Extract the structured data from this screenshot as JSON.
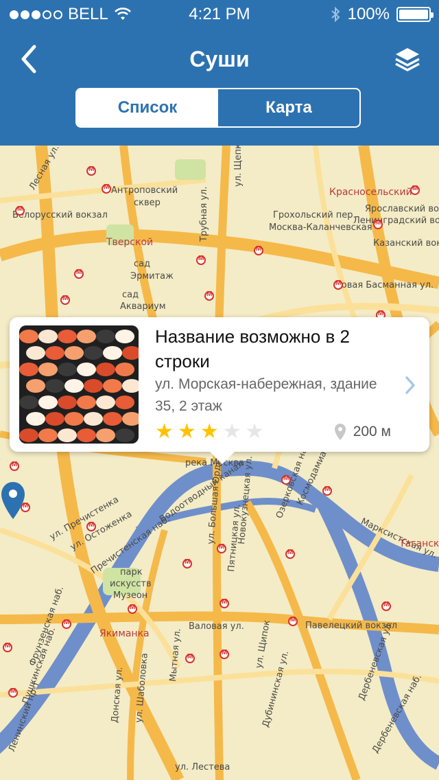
{
  "status_bar": {
    "carrier": "BELL",
    "time": "4:21 PM",
    "battery": "100%",
    "signal_dots_filled": 3,
    "signal_dots_total": 5
  },
  "nav": {
    "title": "Суши",
    "back_icon": "chevron-left-icon",
    "layers_icon": "layers-icon"
  },
  "segments": [
    {
      "label": "Список",
      "active": true
    },
    {
      "label": "Карта",
      "active": false
    }
  ],
  "map": {
    "labels": [
      {
        "text": "Антроповский",
        "cls": ""
      },
      {
        "text": "сквер",
        "cls": ""
      },
      {
        "text": "Белорусский вокзал",
        "cls": ""
      },
      {
        "text": "Тверской",
        "cls": "red"
      },
      {
        "text": "сад",
        "cls": ""
      },
      {
        "text": "Эрмитаж",
        "cls": ""
      },
      {
        "text": "сад",
        "cls": ""
      },
      {
        "text": "Аквариум",
        "cls": ""
      },
      {
        "text": "Грохольский пер.",
        "cls": ""
      },
      {
        "text": "Москва-Каланчевская",
        "cls": ""
      },
      {
        "text": "Красносельский",
        "cls": "red"
      },
      {
        "text": "Ярославский вокзал",
        "cls": ""
      },
      {
        "text": "Ленинградский вокзал",
        "cls": ""
      },
      {
        "text": "Казанский вокзал",
        "cls": ""
      },
      {
        "text": "Новая Басманная ул.",
        "cls": ""
      },
      {
        "text": "Трубная ул.",
        "cls": ""
      },
      {
        "text": "ул. Щепкина",
        "cls": ""
      },
      {
        "text": "Лесная ул.",
        "cls": ""
      },
      {
        "text": "ул. Пречистенка",
        "cls": ""
      },
      {
        "text": "ул. Остоженка",
        "cls": ""
      },
      {
        "text": "Пречистенская наб.",
        "cls": ""
      },
      {
        "text": "парк",
        "cls": ""
      },
      {
        "text": "искусств",
        "cls": ""
      },
      {
        "text": "Музеон",
        "cls": ""
      },
      {
        "text": "Якиманка",
        "cls": "red"
      },
      {
        "text": "Фрунзенская наб.",
        "cls": ""
      },
      {
        "text": "Пушкинская наб.",
        "cls": ""
      },
      {
        "text": "Ленинский пр-т",
        "cls": ""
      },
      {
        "text": "Валовая ул.",
        "cls": ""
      },
      {
        "text": "Павелецкий вокзал",
        "cls": ""
      },
      {
        "text": "Мытная ул.",
        "cls": ""
      },
      {
        "text": "ул. Шаболовка",
        "cls": ""
      },
      {
        "text": "Донская ул.",
        "cls": ""
      },
      {
        "text": "ул. Лестева",
        "cls": ""
      },
      {
        "text": "Дубининская ул.",
        "cls": ""
      },
      {
        "text": "ул. Большая Ордынка",
        "cls": ""
      },
      {
        "text": "Пятницкая ул.",
        "cls": ""
      },
      {
        "text": "Новокузнецкая ул.",
        "cls": ""
      },
      {
        "text": "Озерковская наб.",
        "cls": ""
      },
      {
        "text": "Космодамианская наб.",
        "cls": ""
      },
      {
        "text": "Марксистская ул.",
        "cls": ""
      },
      {
        "text": "Таганский",
        "cls": "red"
      },
      {
        "text": "Дербеневская ул.",
        "cls": ""
      },
      {
        "text": "Дербеневская наб.",
        "cls": ""
      },
      {
        "text": "ул. Щипок",
        "cls": ""
      },
      {
        "text": "Водоотводный канал",
        "cls": ""
      },
      {
        "text": "река Москва",
        "cls": ""
      }
    ]
  },
  "card": {
    "title": "Название возможно в 2 строки",
    "address": "ул. Морская-набережная, здание 35, 2 этаж",
    "rating": 3,
    "rating_max": 5,
    "distance": "200 м",
    "thumb_icon": "sushi-photo",
    "location_icon": "location-pin-icon",
    "chevron_icon": "chevron-right-icon"
  },
  "colors": {
    "header": "#2d72b0",
    "map_bg": "#f4ecc6",
    "road_major": "#f5b94a",
    "road_minor": "#fbe09a",
    "river": "#6f8fcb",
    "star_on": "#ffc300",
    "star_off": "#e6e6e6",
    "pin": "#2d72b0"
  }
}
